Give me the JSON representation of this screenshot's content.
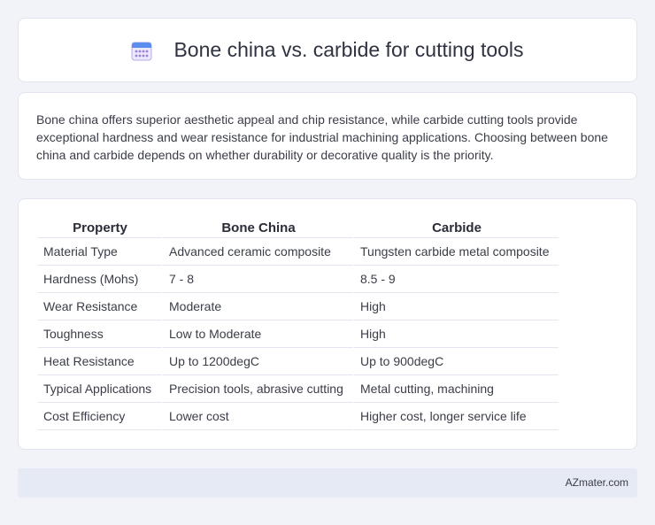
{
  "header": {
    "title": "Bone china vs. carbide for cutting tools",
    "icon": "calendar-icon"
  },
  "intro": {
    "text": "Bone china offers superior aesthetic appeal and chip resistance, while carbide cutting tools provide exceptional hardness and wear resistance for industrial machining applications. Choosing between bone china and carbide depends on whether durability or decorative quality is the priority."
  },
  "table": {
    "headers": [
      "Property",
      "Bone China",
      "Carbide"
    ],
    "rows": [
      [
        "Material Type",
        "Advanced ceramic composite",
        "Tungsten carbide metal composite"
      ],
      [
        "Hardness (Mohs)",
        "7 - 8",
        "8.5 - 9"
      ],
      [
        "Wear Resistance",
        "Moderate",
        "High"
      ],
      [
        "Toughness",
        "Low to Moderate",
        "High"
      ],
      [
        "Heat Resistance",
        "Up to 1200degC",
        "Up to 900degC"
      ],
      [
        "Typical Applications",
        "Precision tools, abrasive cutting",
        "Metal cutting, machining"
      ],
      [
        "Cost Efficiency",
        "Lower cost",
        "Higher cost, longer service life"
      ]
    ]
  },
  "footer": {
    "site": "AZmater.com"
  },
  "colors": {
    "background": "#f1f3f9",
    "card": "#ffffff",
    "footer_bg": "#e6eaf5",
    "icon_blue": "#5b8def",
    "icon_purple": "#9b7fd8"
  }
}
